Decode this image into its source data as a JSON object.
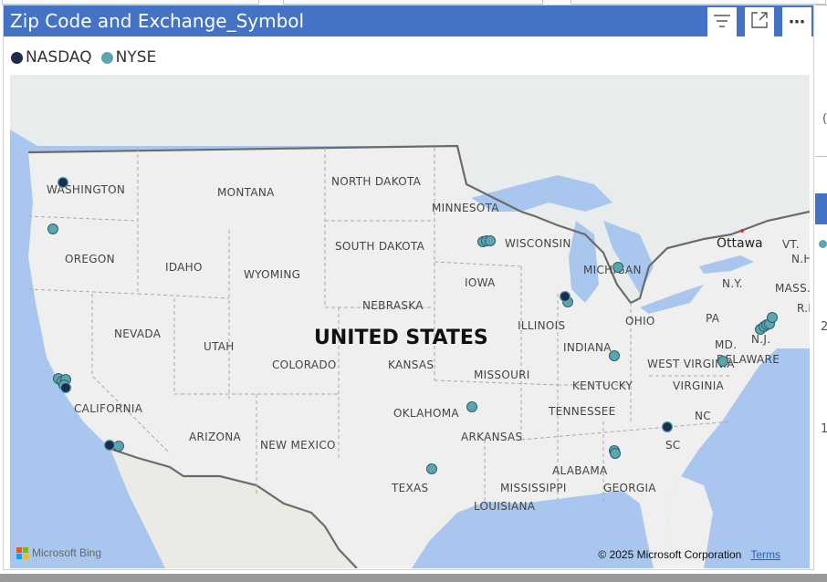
{
  "visual": {
    "title": "Zip Code and Exchange_Symbol",
    "header_buttons": [
      {
        "name": "filter",
        "icon": "filter-icon"
      },
      {
        "name": "focus-mode",
        "icon": "expand-icon"
      },
      {
        "name": "more-options",
        "icon": "more-options-icon",
        "glyph": "⋯"
      }
    ],
    "accent_color": "#4472c4"
  },
  "legend": {
    "items": [
      {
        "label": "NASDAQ",
        "color": "#1c2c4f"
      },
      {
        "label": "NYSE",
        "color": "#5ba5b3"
      }
    ]
  },
  "map": {
    "country_label": "UNITED STATES",
    "city_label": "Ottawa",
    "region_labels": [
      "WASHINGTON",
      "MONTANA",
      "NORTH DAKOTA",
      "MINNESOTA",
      "OREGON",
      "IDAHO",
      "WYOMING",
      "SOUTH DAKOTA",
      "WISCONSIN",
      "MICHIGAN",
      "IOWA",
      "NEBRASKA",
      "NEVADA",
      "UTAH",
      "COLORADO",
      "KANSAS",
      "ILLINOIS",
      "INDIANA",
      "OHIO",
      "PA",
      "N.Y.",
      "MASS.",
      "R.I.",
      "VT.",
      "N.H.",
      "N.J.",
      "MD.",
      "DELAWARE",
      "WEST VIRGINIA",
      "VIRGINIA",
      "KENTUCKY",
      "MISSOURI",
      "CALIFORNIA",
      "ARIZONA",
      "NEW MEXICO",
      "OKLAHOMA",
      "ARKANSAS",
      "TENNESSEE",
      "NC",
      "SC",
      "ALABAMA",
      "GEORGIA",
      "MISSISSIPPI",
      "LOUISIANA",
      "TEXAS"
    ],
    "attribution": "Microsoft Bing",
    "copyright": "© 2025 Microsoft Corporation",
    "terms_label": "Terms",
    "nasdaq_points": 6,
    "nyse_points": 28
  },
  "right_panel": {
    "fragments": [
      "(",
      "2",
      "1"
    ]
  }
}
